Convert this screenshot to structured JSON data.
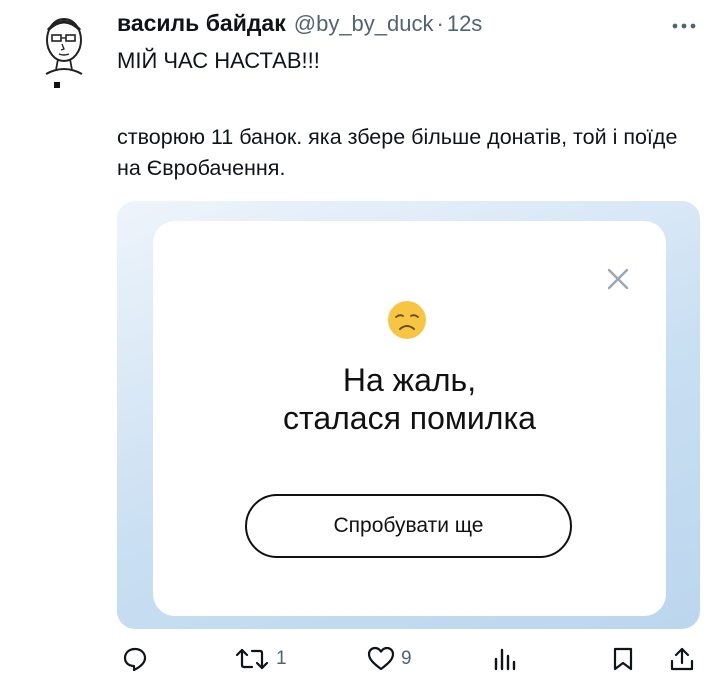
{
  "tweet": {
    "author_name": "василь байдак",
    "handle": "@by_by_duck",
    "separator": "·",
    "time": "12s",
    "text_line1": "МІЙ ЧАС НАСТАВ!!!",
    "text_line2": "створюю 11 банок. яка збере більше донатів, той і поїде на Євробачення."
  },
  "error_card": {
    "title_line1": "На жаль,",
    "title_line2": "сталася помилка",
    "retry_label": "Спробувати ще",
    "emoji": "disappointed-face"
  },
  "actions": {
    "reply_icon": "reply-icon",
    "retweet_count": "1",
    "like_count": "9",
    "views_icon": "views-icon",
    "bookmark_icon": "bookmark-icon",
    "share_icon": "share-icon"
  },
  "colors": {
    "text": "#0f1419",
    "secondary": "#536471",
    "media_bg": "#c9dff2",
    "emoji_yellow": "#f7c544"
  }
}
